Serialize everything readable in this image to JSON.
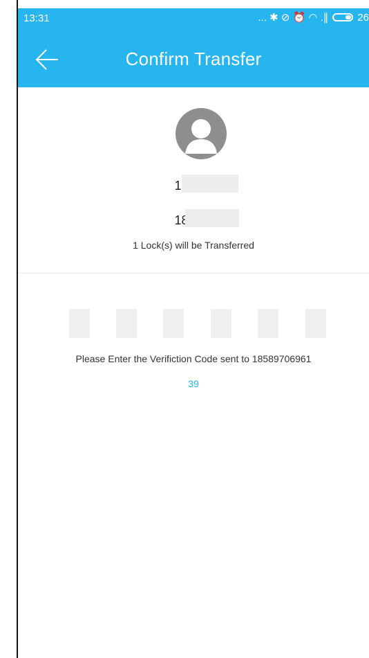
{
  "status_bar": {
    "time": "13:31",
    "indicators": "... ✱ ⊘ ⏰ ◠ .∥",
    "battery_text": "26",
    "icons": [
      "more-dots-icon",
      "bluetooth-icon",
      "no-disturb-icon",
      "alarm-icon",
      "wifi-icon",
      "signal-icon",
      "battery-icon"
    ]
  },
  "app_bar": {
    "title": "Confirm Transfer",
    "back_icon": "back-arrow-icon"
  },
  "transfer": {
    "from_account": "180 01",
    "to_account": "1806 1",
    "note": "1 Lock(s) will be Transferred"
  },
  "verification": {
    "code_boxes": 6,
    "instructions": "Please Enter the Verifiction Code sent to 18589706961",
    "countdown": "39"
  },
  "colors": {
    "primary": "#27b5ef",
    "avatar": "#8e8e8e",
    "code_box": "#efefef"
  }
}
